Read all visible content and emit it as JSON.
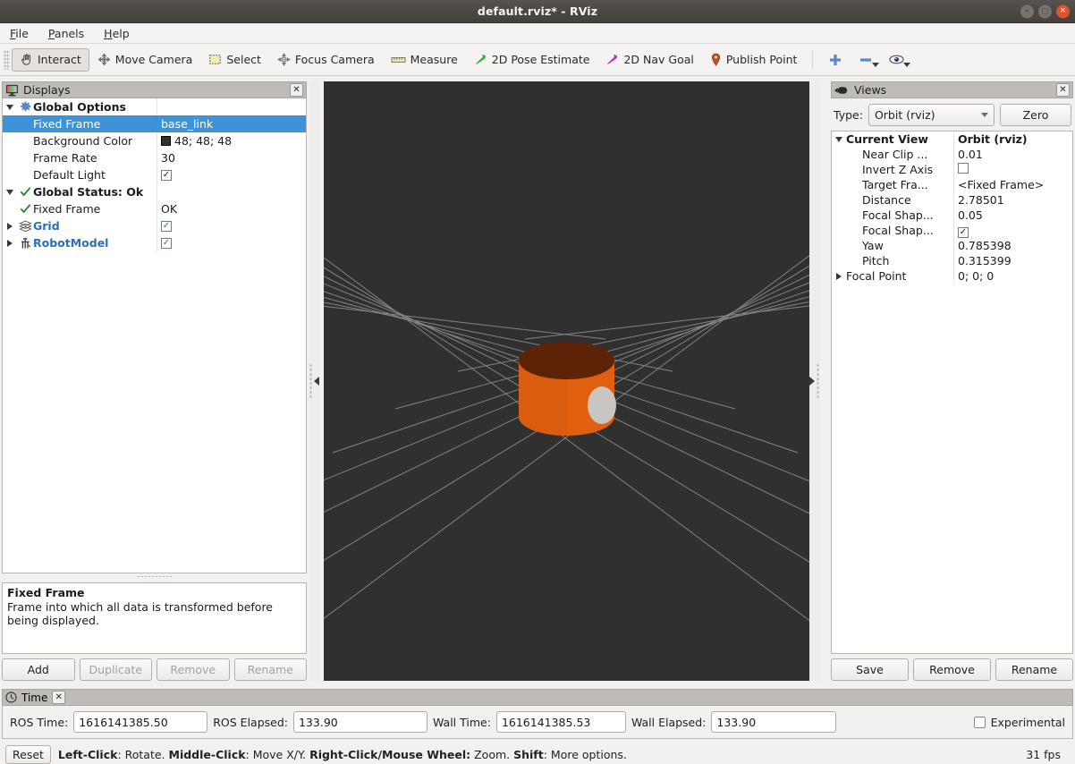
{
  "window": {
    "title": "default.rviz* - RViz",
    "minimize_label": "–",
    "maximize_label": "□",
    "close_label": "✕"
  },
  "menu": {
    "items": [
      {
        "label": "File",
        "mnemonic": "F"
      },
      {
        "label": "Panels",
        "mnemonic": "P"
      },
      {
        "label": "Help",
        "mnemonic": "H"
      }
    ]
  },
  "toolbar": {
    "buttons": [
      {
        "label": "Interact",
        "icon": "hand-cursor-icon",
        "active": true
      },
      {
        "label": "Move Camera",
        "icon": "move-camera-icon",
        "active": false
      },
      {
        "label": "Select",
        "icon": "select-rect-icon",
        "active": false
      },
      {
        "label": "Focus Camera",
        "icon": "focus-camera-icon",
        "active": false
      },
      {
        "label": "Measure",
        "icon": "measure-ruler-icon",
        "active": false
      },
      {
        "label": "2D Pose Estimate",
        "icon": "green-arrow-icon",
        "active": false
      },
      {
        "label": "2D Nav Goal",
        "icon": "magenta-arrow-icon",
        "active": false
      },
      {
        "label": "Publish Point",
        "icon": "map-pin-icon",
        "active": false
      }
    ],
    "extra_icons": [
      {
        "name": "add-tool-icon",
        "glyph": "+"
      },
      {
        "name": "remove-tool-icon",
        "glyph": "−"
      },
      {
        "name": "visibility-eye-icon",
        "glyph": "eye"
      }
    ]
  },
  "displays": {
    "title": "Displays",
    "close_label": "✕",
    "rows": [
      {
        "twisty": "down",
        "icon": "gear-icon",
        "label": "Global Options",
        "style": "bold",
        "value_type": "none",
        "value": "",
        "indent": 0,
        "selected": false
      },
      {
        "twisty": "none",
        "icon": "none",
        "label": "Fixed Frame",
        "style": "plain",
        "value_type": "text",
        "value": "base_link",
        "indent": 1,
        "selected": true
      },
      {
        "twisty": "none",
        "icon": "none",
        "label": "Background Color",
        "style": "plain",
        "value_type": "color",
        "value": "48; 48; 48",
        "indent": 1,
        "selected": false
      },
      {
        "twisty": "none",
        "icon": "none",
        "label": "Frame Rate",
        "style": "plain",
        "value_type": "text",
        "value": "30",
        "indent": 1,
        "selected": false
      },
      {
        "twisty": "none",
        "icon": "none",
        "label": "Default Light",
        "style": "plain",
        "value_type": "checkbox",
        "value": "checked",
        "indent": 1,
        "selected": false
      },
      {
        "twisty": "down",
        "icon": "check-icon",
        "label": "Global Status: Ok",
        "style": "bold",
        "value_type": "none",
        "value": "",
        "indent": 0,
        "selected": false
      },
      {
        "twisty": "none",
        "icon": "check-icon",
        "label": "Fixed Frame",
        "style": "plain",
        "value_type": "text",
        "value": "OK",
        "indent": 1,
        "selected": false
      },
      {
        "twisty": "right",
        "icon": "grid-icon",
        "label": "Grid",
        "style": "blue",
        "value_type": "checkbox",
        "value": "checked",
        "indent": 0,
        "selected": false
      },
      {
        "twisty": "right",
        "icon": "robotmodel-icon",
        "label": "RobotModel",
        "style": "blue",
        "value_type": "checkbox",
        "value": "checked",
        "indent": 0,
        "selected": false
      }
    ],
    "help": {
      "title": "Fixed Frame",
      "body": "Frame into which all data is transformed before being displayed."
    },
    "buttons": [
      {
        "label": "Add",
        "enabled": true
      },
      {
        "label": "Duplicate",
        "enabled": false
      },
      {
        "label": "Remove",
        "enabled": false
      },
      {
        "label": "Rename",
        "enabled": false
      }
    ]
  },
  "views": {
    "title": "Views",
    "close_label": "✕",
    "type_label": "Type:",
    "type_value": "Orbit (rviz)",
    "zero_label": "Zero",
    "rows": [
      {
        "twisty": "down",
        "label": "Current View",
        "style": "bold",
        "value_type": "text",
        "value": "Orbit (rviz)",
        "indent": 0
      },
      {
        "twisty": "none",
        "label": "Near Clip ...",
        "style": "plain",
        "value_type": "text",
        "value": "0.01",
        "indent": 1
      },
      {
        "twisty": "none",
        "label": "Invert Z Axis",
        "style": "plain",
        "value_type": "checkbox",
        "value": "unchecked",
        "indent": 1
      },
      {
        "twisty": "none",
        "label": "Target Fra...",
        "style": "plain",
        "value_type": "text",
        "value": "<Fixed Frame>",
        "indent": 1
      },
      {
        "twisty": "none",
        "label": "Distance",
        "style": "plain",
        "value_type": "text",
        "value": "2.78501",
        "indent": 1
      },
      {
        "twisty": "none",
        "label": "Focal Shap...",
        "style": "plain",
        "value_type": "text",
        "value": "0.05",
        "indent": 1
      },
      {
        "twisty": "none",
        "label": "Focal Shap...",
        "style": "plain",
        "value_type": "checkbox",
        "value": "checked",
        "indent": 1
      },
      {
        "twisty": "none",
        "label": "Yaw",
        "style": "plain",
        "value_type": "text",
        "value": "0.785398",
        "indent": 1
      },
      {
        "twisty": "none",
        "label": "Pitch",
        "style": "plain",
        "value_type": "text",
        "value": "0.315399",
        "indent": 1
      },
      {
        "twisty": "right",
        "label": "Focal Point",
        "style": "plain",
        "value_type": "text",
        "value": "0; 0; 0",
        "indent": 1
      }
    ],
    "buttons": [
      {
        "label": "Save",
        "enabled": true
      },
      {
        "label": "Remove",
        "enabled": true
      },
      {
        "label": "Rename",
        "enabled": true
      }
    ]
  },
  "viewport": {
    "background_color": "#303030",
    "grid_color": "#9a9a9a",
    "robot": {
      "cylinder_side_color": "#e06010",
      "cylinder_top_color": "#5c2306",
      "sphere_color": "#c9c5c0"
    }
  },
  "time": {
    "title": "Time",
    "fields": [
      {
        "label": "ROS Time:",
        "value": "1616141385.50"
      },
      {
        "label": "ROS Elapsed:",
        "value": "133.90"
      },
      {
        "label": "Wall Time:",
        "value": "1616141385.53"
      },
      {
        "label": "Wall Elapsed:",
        "value": "133.90"
      }
    ],
    "experimental_label": "Experimental",
    "experimental_checked": false,
    "close_label": "✕"
  },
  "statusbar": {
    "reset_label": "Reset",
    "hint_parts": [
      {
        "text": "Left-Click",
        "bold": true
      },
      {
        "text": ": Rotate. ",
        "bold": false
      },
      {
        "text": "Middle-Click",
        "bold": true
      },
      {
        "text": ": Move X/Y. ",
        "bold": false
      },
      {
        "text": "Right-Click/Mouse Wheel:",
        "bold": true
      },
      {
        "text": " Zoom. ",
        "bold": false
      },
      {
        "text": "Shift",
        "bold": true
      },
      {
        "text": ": More options.",
        "bold": false
      }
    ],
    "fps": "31 fps"
  }
}
